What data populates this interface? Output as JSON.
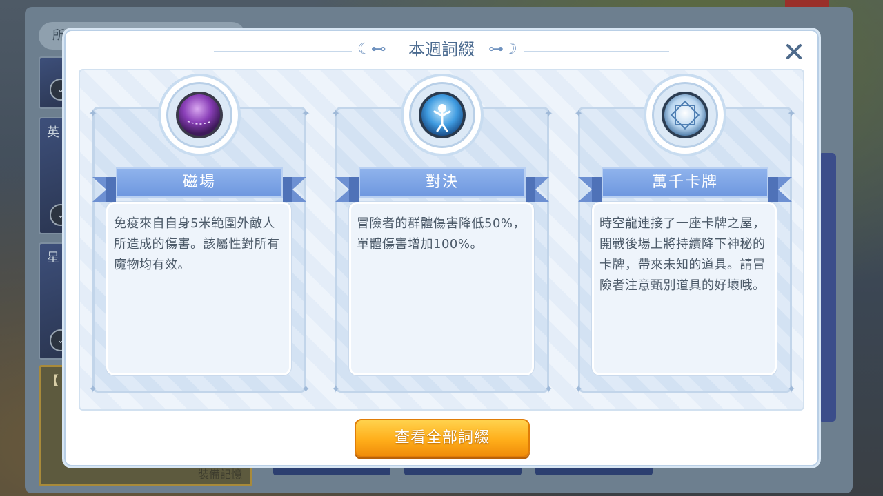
{
  "background": {
    "search_prefix": "所",
    "card_labels": [
      "英",
      "星"
    ],
    "bracket_card_prefix": "【 滬",
    "bracket_card_footer": "裝備記憶"
  },
  "dialog": {
    "title": "本週詞綴",
    "close_icon": "close-icon",
    "title_ornament_left": "☾⊷",
    "title_ornament_right": "⊶☽"
  },
  "affixes": [
    {
      "name": "磁場",
      "icon": "purple-dome-icon",
      "description": "免疫來自自身5米範圍外敵人所造成的傷害。該屬性對所有魔物均有效。"
    },
    {
      "name": "對決",
      "icon": "duel-figure-icon",
      "description": "冒險者的群體傷害降低50%，單體傷害增加100%。"
    },
    {
      "name": "萬千卡牌",
      "icon": "card-diamond-icon",
      "description": "時空龍連接了一座卡牌之屋，開戰後場上將持續降下神秘的卡牌，帶來未知的道具。請冒險者注意甄別道具的好壞哦。"
    }
  ],
  "footer": {
    "view_all_label": "查看全部詞綴"
  },
  "colors": {
    "title": "#4a6a8f",
    "ribbon": "#7aa0e3",
    "button": "#ffae1a",
    "text": "#4c5a69"
  }
}
